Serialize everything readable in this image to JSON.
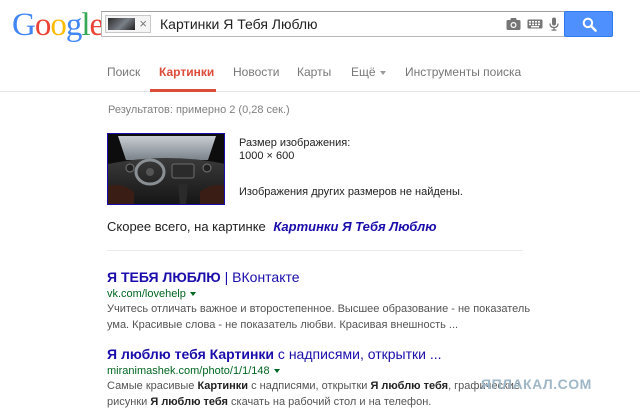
{
  "logo": {
    "letters": [
      "G",
      "o",
      "o",
      "g",
      "l",
      "e"
    ],
    "colors": [
      "#4285f4",
      "#ea4335",
      "#fbbc05",
      "#4285f4",
      "#34a853",
      "#ea4335"
    ]
  },
  "search": {
    "query": "Картинки Я Тебя Люблю",
    "chip_close": "×"
  },
  "icons": {
    "camera": "camera-icon",
    "keyboard": "keyboard-icon",
    "mic": "mic-icon",
    "search": "search-icon"
  },
  "tabs": [
    {
      "label": "Поиск",
      "active": false
    },
    {
      "label": "Картинки",
      "active": true
    },
    {
      "label": "Новости",
      "active": false
    },
    {
      "label": "Карты",
      "active": false
    },
    {
      "label": "Ещё",
      "active": false,
      "dropdown": true
    },
    {
      "label": "Инструменты поиска",
      "active": false
    }
  ],
  "stats": "Результатов: примерно 2 (0,28 сек.)",
  "image_info": {
    "size_label": "Размер изображения:",
    "size_value": "1000 × 600",
    "other_sizes": "Изображения других размеров не найдены."
  },
  "best_guess": {
    "prefix": "Скорее всего, на картинке",
    "link": "Картинки Я Тебя Люблю"
  },
  "results": [
    {
      "title_bold": "Я ТЕБЯ ЛЮБЛЮ",
      "title_rest": " | ВКонтакте",
      "url": "vk.com/lovehelp",
      "snippet_lines": [
        "Учитесь отличать важное и второстепенное. Высшее образование - не показатель",
        "ума. Красивые слова - не показатель любви. Красивая внешность ..."
      ]
    },
    {
      "title_bold": "Я люблю тебя Картинки",
      "title_rest": " с надписями, открытки ...",
      "url": "miranimashek.com/photo/1/1/148",
      "snippet_1a": "Самые красивые ",
      "snippet_1b": "Картинки",
      "snippet_1c": " с надписями, открытки ",
      "snippet_1d": "Я люблю тебя",
      "snippet_1e": ", графические",
      "snippet_2a": "рисунки ",
      "snippet_2b": "Я люблю тебя",
      "snippet_2c": " скачать на рабочий стол и на телефон."
    }
  ],
  "watermark": "ЯПЛАКАЛ.COM"
}
